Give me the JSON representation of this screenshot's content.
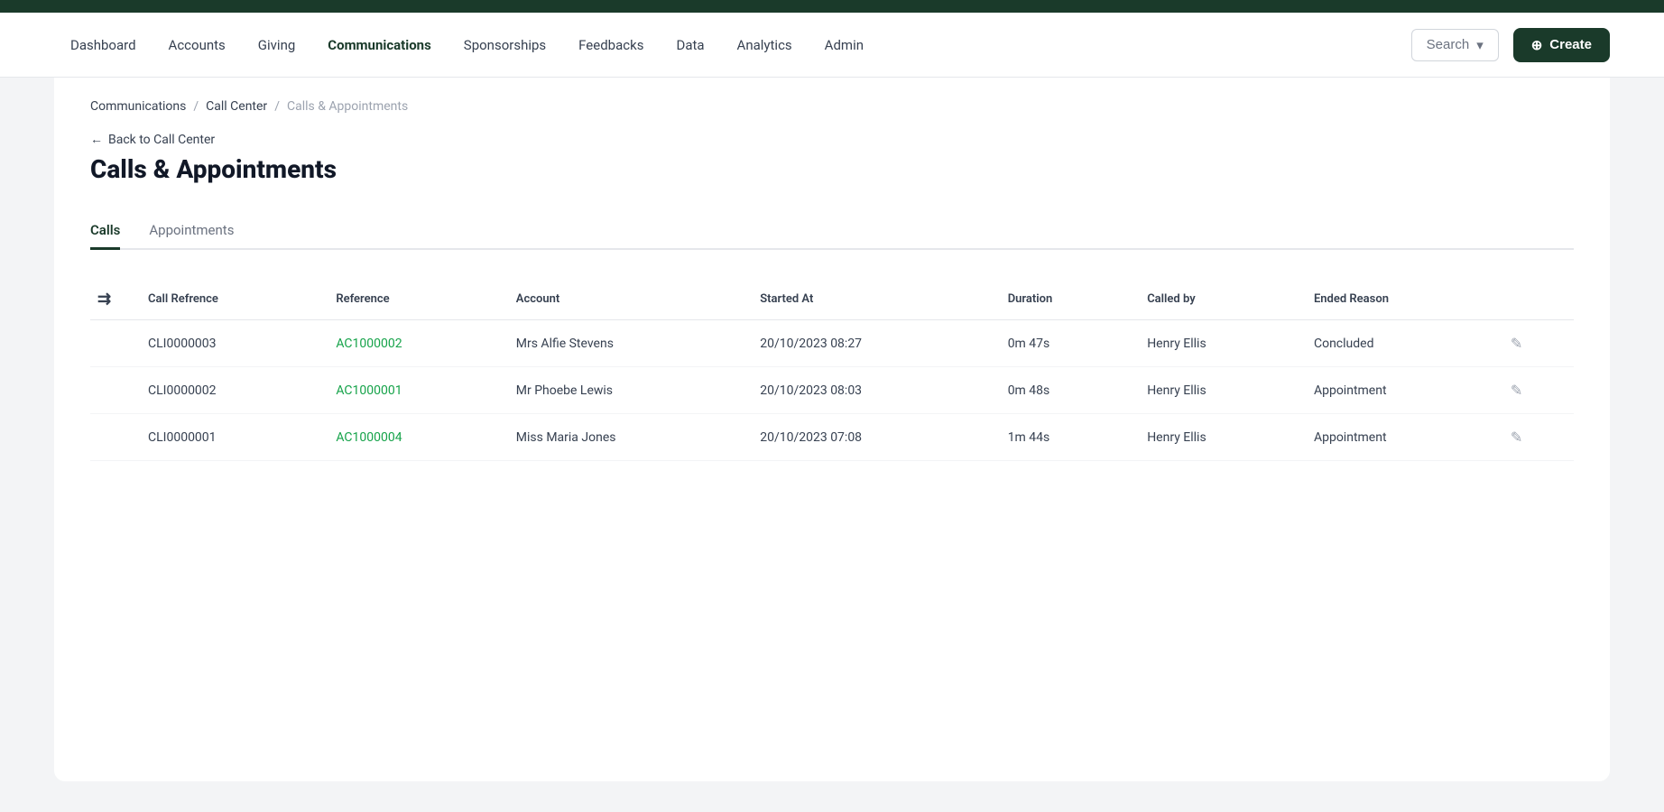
{
  "topbar": {},
  "nav": {
    "items": [
      {
        "label": "Dashboard",
        "active": false
      },
      {
        "label": "Accounts",
        "active": false
      },
      {
        "label": "Giving",
        "active": false
      },
      {
        "label": "Communications",
        "active": true
      },
      {
        "label": "Sponsorships",
        "active": false
      },
      {
        "label": "Feedbacks",
        "active": false
      },
      {
        "label": "Data",
        "active": false
      },
      {
        "label": "Analytics",
        "active": false
      },
      {
        "label": "Admin",
        "active": false
      }
    ],
    "search_label": "Search",
    "create_label": "Create"
  },
  "breadcrumb": {
    "items": [
      {
        "label": "Communications",
        "link": true
      },
      {
        "label": "Call Center",
        "link": true
      },
      {
        "label": "Calls & Appointments",
        "link": false
      }
    ]
  },
  "back_link": "Back to Call Center",
  "page_title": "Calls & Appointments",
  "tabs": [
    {
      "label": "Calls",
      "active": true
    },
    {
      "label": "Appointments",
      "active": false
    }
  ],
  "table": {
    "columns": [
      {
        "label": "Call Refrence"
      },
      {
        "label": "Reference"
      },
      {
        "label": "Account"
      },
      {
        "label": "Started At"
      },
      {
        "label": "Duration"
      },
      {
        "label": "Called by"
      },
      {
        "label": "Ended Reason"
      }
    ],
    "rows": [
      {
        "call_ref": "CLI0000003",
        "reference": "AC1000002",
        "account": "Mrs Alfie Stevens",
        "started_at": "20/10/2023 08:27",
        "duration": "0m 47s",
        "called_by": "Henry Ellis",
        "ended_reason": "Concluded"
      },
      {
        "call_ref": "CLI0000002",
        "reference": "AC1000001",
        "account": "Mr Phoebe Lewis",
        "started_at": "20/10/2023 08:03",
        "duration": "0m 48s",
        "called_by": "Henry Ellis",
        "ended_reason": "Appointment"
      },
      {
        "call_ref": "CLI0000001",
        "reference": "AC1000004",
        "account": "Miss Maria Jones",
        "started_at": "20/10/2023 07:08",
        "duration": "1m 44s",
        "called_by": "Henry Ellis",
        "ended_reason": "Appointment"
      }
    ]
  }
}
